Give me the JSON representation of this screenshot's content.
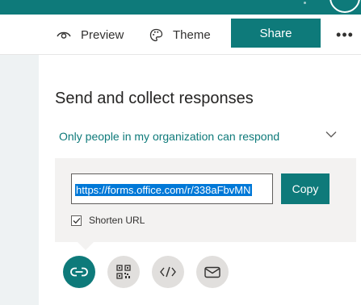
{
  "toolbar": {
    "preview_label": "Preview",
    "theme_label": "Theme",
    "share_label": "Share",
    "more_label": "•••"
  },
  "panel": {
    "title": "Send and collect responses",
    "permission": "Only people in my organization can respond",
    "link_url": "https://forms.office.com/r/338aFbvMN",
    "copy_label": "Copy",
    "shorten_label": "Shorten URL",
    "shorten_checked": true
  },
  "send_methods": [
    "link-icon",
    "qr-code-icon",
    "embed-icon",
    "mail-icon"
  ],
  "colors": {
    "accent": "#0e7a7a",
    "selection": "#0078d7"
  }
}
